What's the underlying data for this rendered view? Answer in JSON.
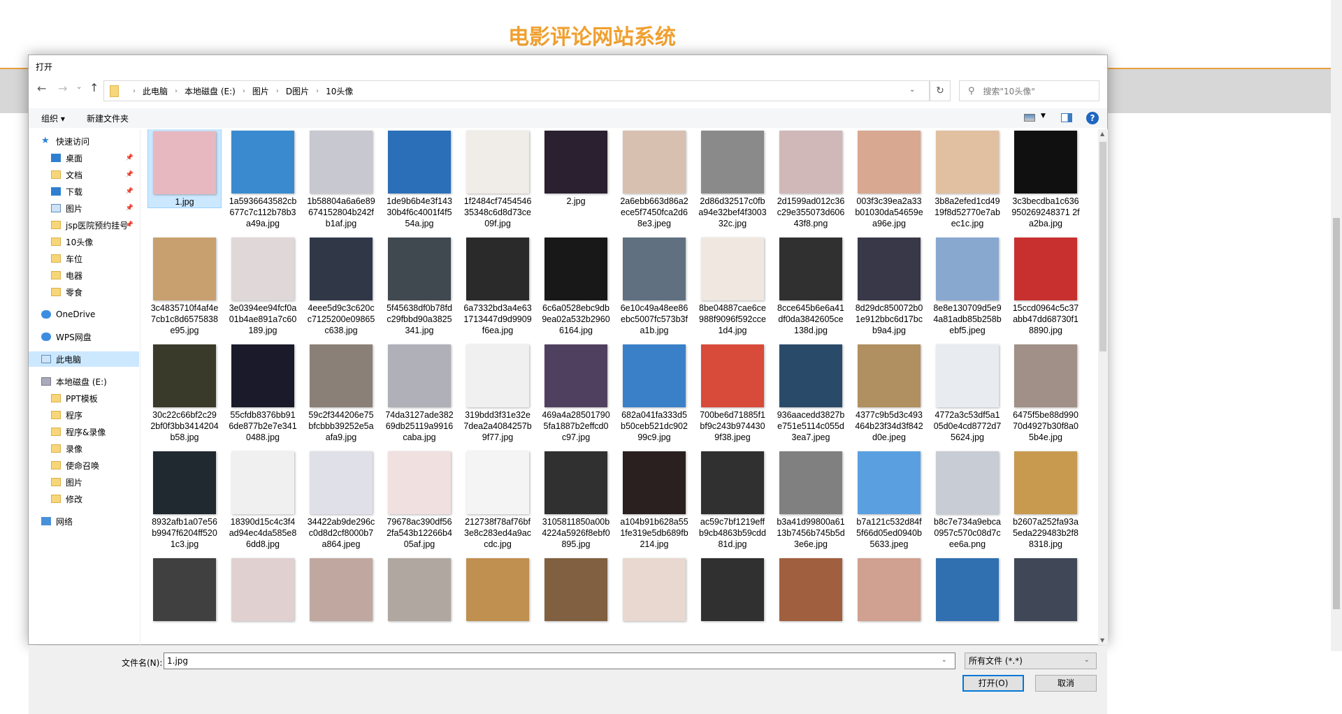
{
  "site": {
    "title": "电影评论网站系统",
    "accent": "#f0a030"
  },
  "dialog": {
    "title": "打开",
    "breadcrumb": [
      "此电脑",
      "本地磁盘 (E:)",
      "图片",
      "D图片",
      "10头像"
    ],
    "search_placeholder": "搜索\"10头像\"",
    "toolbar": {
      "organize": "组织 ▾",
      "new_folder": "新建文件夹"
    },
    "sidebar": [
      {
        "label": "快速访问",
        "icon": "star",
        "indent": 0
      },
      {
        "label": "桌面",
        "icon": "blue",
        "indent": 1,
        "pinned": true
      },
      {
        "label": "文档",
        "icon": "fold",
        "indent": 1,
        "pinned": true
      },
      {
        "label": "下载",
        "icon": "blue",
        "indent": 1,
        "pinned": true
      },
      {
        "label": "图片",
        "icon": "pc",
        "indent": 1,
        "pinned": true
      },
      {
        "label": "jsp医院预约挂号",
        "icon": "fold",
        "indent": 1,
        "pinned": true
      },
      {
        "label": "10头像",
        "icon": "fold",
        "indent": 1
      },
      {
        "label": "车位",
        "icon": "fold",
        "indent": 1
      },
      {
        "label": "电器",
        "icon": "fold",
        "indent": 1
      },
      {
        "label": "零食",
        "icon": "fold",
        "indent": 1
      },
      {
        "label": "OneDrive",
        "icon": "cloud",
        "indent": 0,
        "gap": true
      },
      {
        "label": "WPS网盘",
        "icon": "cloud",
        "indent": 0,
        "gap": true
      },
      {
        "label": "此电脑",
        "icon": "pc",
        "indent": 0,
        "gap": true,
        "selected": true
      },
      {
        "label": "本地磁盘 (E:)",
        "icon": "drive",
        "indent": 0,
        "gap": true
      },
      {
        "label": "PPT模板",
        "icon": "fold",
        "indent": 1
      },
      {
        "label": "程序",
        "icon": "fold",
        "indent": 1
      },
      {
        "label": "程序&录像",
        "icon": "fold",
        "indent": 1
      },
      {
        "label": "录像",
        "icon": "fold",
        "indent": 1
      },
      {
        "label": "使命召唤",
        "icon": "fold",
        "indent": 1
      },
      {
        "label": "图片",
        "icon": "fold",
        "indent": 1
      },
      {
        "label": "修改",
        "icon": "fold",
        "indent": 1
      },
      {
        "label": "网络",
        "icon": "net",
        "indent": 0,
        "gap": true
      }
    ],
    "files": [
      "1.jpg",
      "1a5936643582cb677c7c112b78b3a49a.jpg",
      "1b58804a6a6e89674152804b242fb1af.jpg",
      "1de9b6b4e3f14330b4f6c4001f4f554a.jpg",
      "1f2484cf745454635348c6d8d73ce09f.jpg",
      "2.jpg",
      "2a6ebb663d86a2ece5f7450fca2d68e3.jpeg",
      "2d86d32517c0fba94e32bef4f300332c.jpg",
      "2d1599ad012c36c29e355073d60643f8.png",
      "003f3c39ea2a33b01030da54659ea96e.jpg",
      "3b8a2efed1cd4919f8d52770e7abec1c.jpg",
      "3c3becdba1c636950269248371 2fa2ba.jpg",
      "3c4835710f4af4e7cb1c8d6575838e95.jpg",
      "3e0394ee94fcf0a01b4ae891a7c60189.jpg",
      "4eee5d9c3c620cc7125200e09865c638.jpg",
      "5f45638df0b78fdc29fbbd90a3825341.jpg",
      "6a7332bd3a4e631713447d9d9909f6ea.jpg",
      "6c6a0528ebc9db9ea02a532b29606164.jpg",
      "6e10c49a48ee86ebc5007fc573b3fa1b.jpg",
      "8be04887cae6ce988f9096f592cce1d4.jpg",
      "8cce645b6e6a41df0da3842605ce138d.jpg",
      "8d29dc850072b01e912bbc6d17bcb9a4.jpg",
      "8e8e130709d5e94a81adb85b258bebf5.jpeg",
      "15ccd0964c5c37abb47dd68730f18890.jpg",
      "30c22c66bf2c292bf0f3bb3414204b58.jpg",
      "55cfdb8376bb916de877b2e7e3410488.jpg",
      "59c2f344206e75bfcbbb39252e5aafa9.jpg",
      "74da3127ade38269db25119a9916caba.jpg",
      "319bdd3f31e32e7dea2a4084257b9f77.jpg",
      "469a4a285017905fa1887b2effcd0c97.jpg",
      "682a041fa333d5b50ceb521dc90299c9.jpg",
      "700be6d71885f1bf9c243b9744309f38.jpeg",
      "936aacedd3827be751e5114c055d3ea7.jpeg",
      "4377c9b5d3c493464b23f34d3f842d0e.jpeg",
      "4772a3c53df5a105d0e4cd8772d75624.jpg",
      "6475f5be88d99070d4927b30f8a05b4e.jpg",
      "8932afb1a07e56b9947f6204ff5201c3.jpg",
      "18390d15c4c3f4ad94ec4da585e86dd8.jpg",
      "34422ab9de296cc0d8d2cf8000b7a864.jpeg",
      "79678ac390df562fa543b12266b405af.jpg",
      "212738f78af76bf3e8c283ed4a9accdc.jpg",
      "3105811850a00b4224a5926f8ebf0895.jpg",
      "a104b91b628a551fe319e5db689fb214.jpg",
      "ac59c7bf1219effb9cb4863b59cdd81d.jpg",
      "b3a41d99800a6113b7456b745b5d3e6e.jpg",
      "b7a121c532d84f5f66d05ed0940b5633.jpeg",
      "b8c7e734a9ebca0957c570c08d7cee6a.png",
      "b2607a252fa93a5eda229483b2f88318.jpg",
      "",
      "",
      "",
      "",
      "",
      "",
      "",
      "",
      "",
      "",
      "",
      ""
    ],
    "thumb_colors": [
      "#e8b8c0",
      "#3a8ad0",
      "#c8c8d0",
      "#2a6fb8",
      "#f0ece8",
      "#2a2030",
      "#d8c0b0",
      "#8a8a8a",
      "#d0b8b8",
      "#d8a890",
      "#e0c0a0",
      "#101010",
      "#c8a070",
      "#e0d8d8",
      "#303848",
      "#404850",
      "#2a2a2a",
      "#181818",
      "#607080",
      "#f0e8e0",
      "#303030",
      "#383848",
      "#88a8d0",
      "#c83030",
      "#3a3a2a",
      "#1a1a2a",
      "#8a8078",
      "#b0b0b8",
      "#f0f0f0",
      "#504060",
      "#3a80c8",
      "#d84a3a",
      "#2a4a6a",
      "#b09060",
      "#e8ecf0",
      "#a09088",
      "#202830",
      "#f0f0f0",
      "#e0e0e8",
      "#f0e0e0",
      "#f4f4f4",
      "#303030",
      "#2a2020",
      "#303030",
      "#808080",
      "#5aa0e0",
      "#c8ccd4",
      "#c89a50",
      "#404040",
      "#e0d0d0",
      "#c0a8a0",
      "#b0a8a0",
      "#c09050",
      "#806040",
      "#e8d8d0",
      "#303030",
      "#a06040",
      "#d0a090",
      "#3070b0",
      "#404858"
    ],
    "filename_label": "文件名(N):",
    "filename_value": "1.jpg",
    "filetype": "所有文件 (*.*)",
    "open_button": "打开(O)",
    "cancel_button": "取消"
  }
}
